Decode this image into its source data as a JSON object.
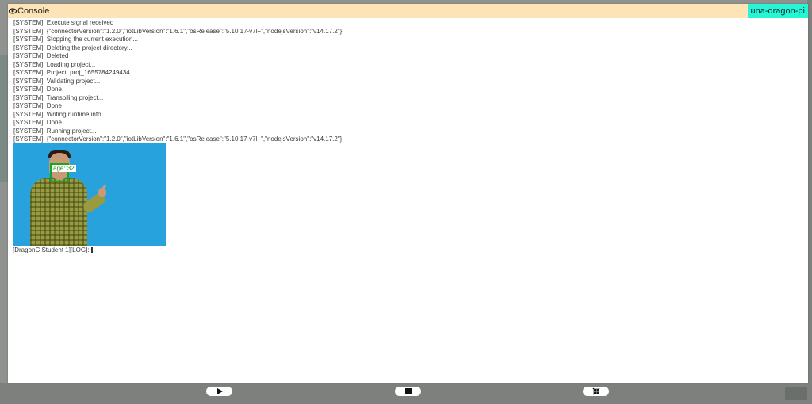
{
  "console": {
    "title": "Console",
    "device": "una-dragon-pi",
    "log_lines": [
      "[SYSTEM]: Execute signal received",
      "[SYSTEM]: {\"connectorVersion\":\"1.2.0\",\"iotLibVersion\":\"1.6.1\",\"osRelease\":\"5.10.17-v7l+\",\"nodejsVersion\":\"v14.17.2\"}",
      "[SYSTEM]: Stopping the current execution...",
      "[SYSTEM]: Deleting the project directory...",
      "[SYSTEM]: Deleted",
      "[SYSTEM]: Loading project...",
      "[SYSTEM]: Project: proj_1655784249434",
      "[SYSTEM]: Validating project...",
      "[SYSTEM]: Done",
      "[SYSTEM]: Transpiling project...",
      "[SYSTEM]: Done",
      "[SYSTEM]: Writing runtime info...",
      "[SYSTEM]: Done",
      "[SYSTEM]: Running project...",
      "[SYSTEM]: {\"connectorVersion\":\"1.2.0\",\"iotLibVersion\":\"1.6.1\",\"osRelease\":\"5.10.17-v7l+\",\"nodejsVersion\":\"v14.17.2\"}"
    ],
    "detection_label": "age: 32",
    "prompt": "[DragonC Student 1][LOG]:"
  },
  "controls": {
    "play_icon": "play-icon",
    "stop_icon": "stop-icon",
    "fullscreen_icon": "collapse-icon"
  },
  "colors": {
    "header_bg": "#fde4b6",
    "device_badge_bg": "#26f5d6",
    "image_bg": "#27a2dd",
    "face_box": "#1aa51a"
  }
}
